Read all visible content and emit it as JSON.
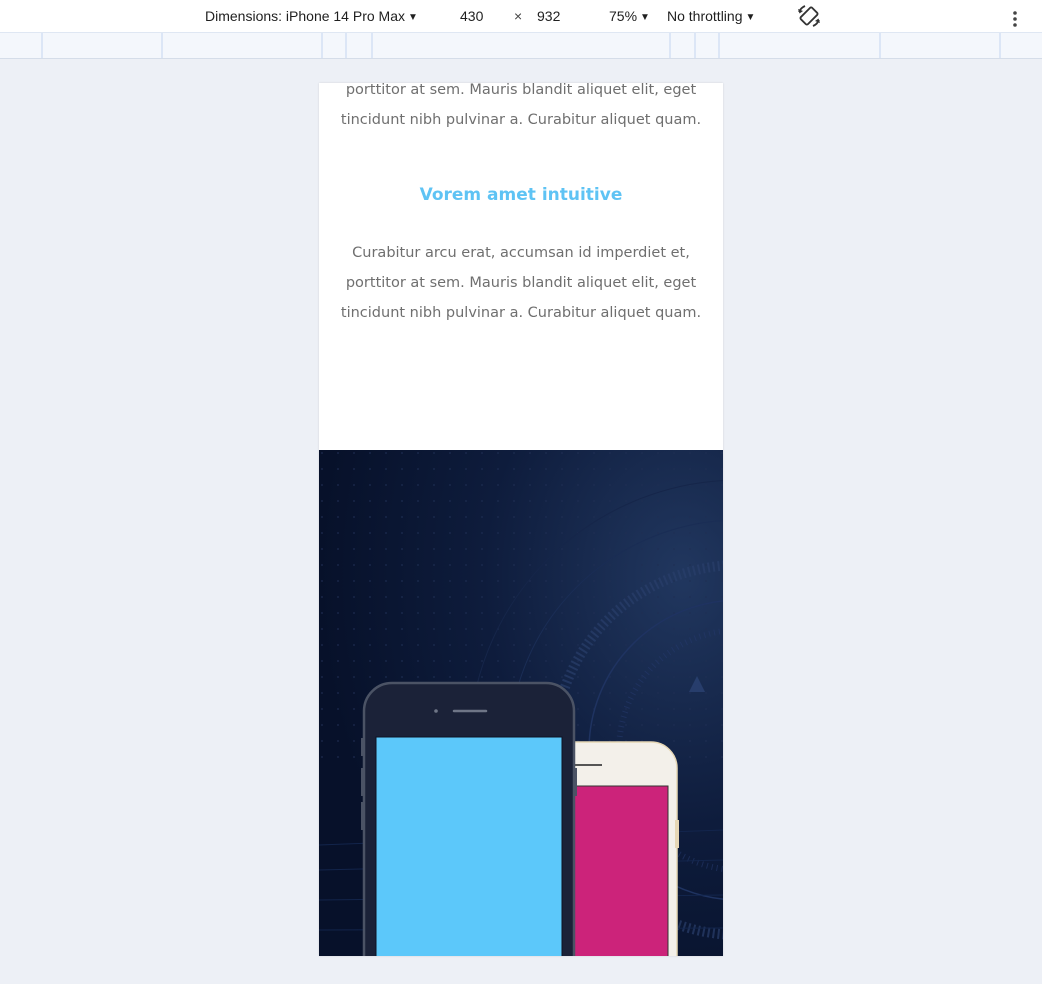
{
  "devtools": {
    "device_label": "Dimensions: iPhone 14 Pro Max",
    "width_value": "430",
    "times_symbol": "×",
    "height_value": "932",
    "zoom_label": "75%",
    "throttle_label": "No throttling",
    "rotate_icon": "rotate-icon",
    "more_icon": "more-vertical-icon",
    "caret_icon": "caret-down-icon"
  },
  "page": {
    "paragraph_top": {
      "lines": [
        "porttitor at sem. Mauris blandit aliquet elit, eget",
        "tincidunt nibh pulvinar a. Curabitur aliquet quam."
      ]
    },
    "heading": "Vorem amet intuitive",
    "paragraph_main": {
      "lines": [
        "Curabitur arcu erat, accumsan id imperdiet et,",
        "porttitor at sem. Mauris blandit aliquet elit, eget",
        "tincidunt nibh pulvinar a. Curabitur aliquet quam."
      ]
    },
    "colors": {
      "heading": "#5ec3f4",
      "hero_bg": "#091530",
      "dark_phone_screen": "#5cc8fa",
      "light_phone_screen": "#cc237a"
    }
  }
}
